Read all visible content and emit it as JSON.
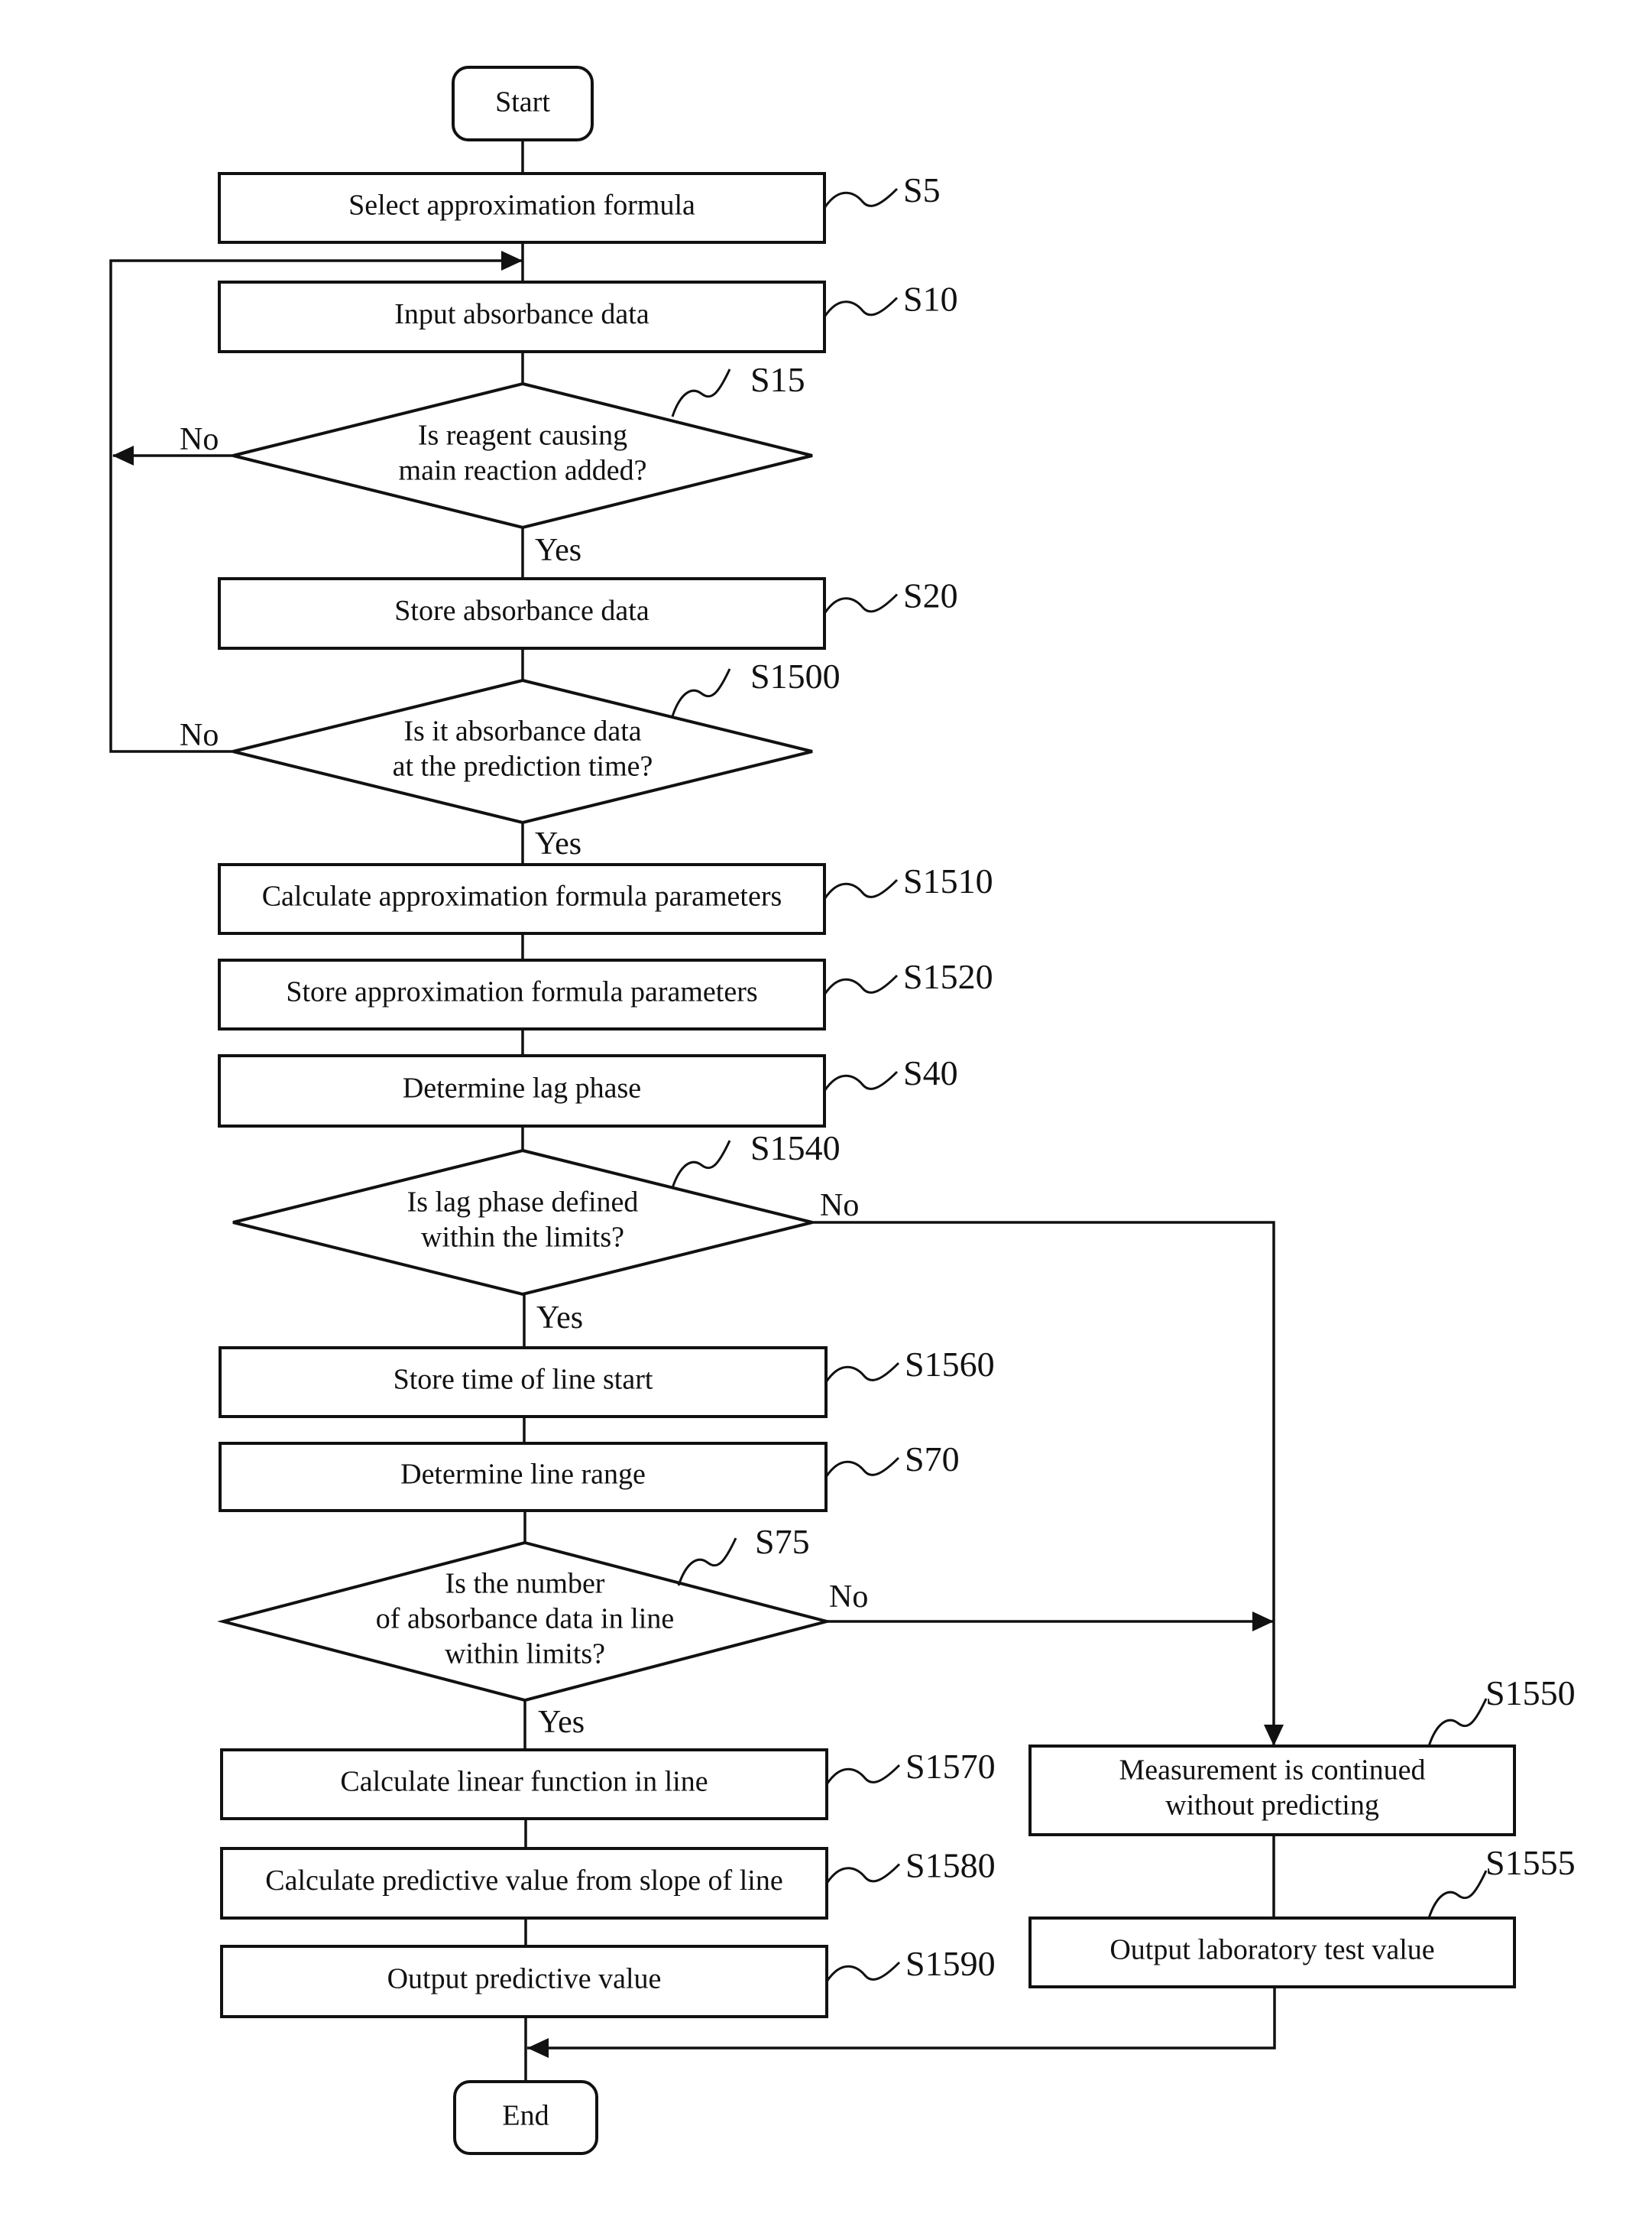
{
  "diagram": {
    "type": "flowchart",
    "terminals": {
      "start": "Start",
      "end": "End"
    },
    "nodes": [
      {
        "id": "S5",
        "kind": "process",
        "lines": [
          "Select approximation formula"
        ]
      },
      {
        "id": "S10",
        "kind": "process",
        "lines": [
          "Input absorbance data"
        ]
      },
      {
        "id": "S15",
        "kind": "decision",
        "lines": [
          "Is reagent causing",
          "main reaction added?"
        ]
      },
      {
        "id": "S20",
        "kind": "process",
        "lines": [
          "Store absorbance data"
        ]
      },
      {
        "id": "S1500",
        "kind": "decision",
        "lines": [
          "Is it absorbance data",
          "at the prediction time?"
        ]
      },
      {
        "id": "S1510",
        "kind": "process",
        "lines": [
          "Calculate approximation formula parameters"
        ]
      },
      {
        "id": "S1520",
        "kind": "process",
        "lines": [
          "Store approximation formula parameters"
        ]
      },
      {
        "id": "S40",
        "kind": "process",
        "lines": [
          "Determine lag phase"
        ]
      },
      {
        "id": "S1540",
        "kind": "decision",
        "lines": [
          "Is lag phase defined",
          "within the limits?"
        ]
      },
      {
        "id": "S1560",
        "kind": "process",
        "lines": [
          "Store time of line start"
        ]
      },
      {
        "id": "S70",
        "kind": "process",
        "lines": [
          "Determine line range"
        ]
      },
      {
        "id": "S75",
        "kind": "decision",
        "lines": [
          "Is the number",
          "of absorbance data in line",
          "within limits?"
        ]
      },
      {
        "id": "S1570",
        "kind": "process",
        "lines": [
          "Calculate linear function in line"
        ]
      },
      {
        "id": "S1580",
        "kind": "process",
        "lines": [
          "Calculate predictive value from slope of line"
        ]
      },
      {
        "id": "S1590",
        "kind": "process",
        "lines": [
          "Output predictive value"
        ]
      },
      {
        "id": "S1550",
        "kind": "process",
        "lines": [
          "Measurement is continued",
          "without predicting"
        ]
      },
      {
        "id": "S1555",
        "kind": "process",
        "lines": [
          "Output laboratory test value"
        ]
      }
    ],
    "branch_labels": {
      "yes": "Yes",
      "no": "No"
    },
    "edges": [
      {
        "from": "Start",
        "to": "S5"
      },
      {
        "from": "S5",
        "to": "S10"
      },
      {
        "from": "S10",
        "to": "S15"
      },
      {
        "from": "S15",
        "to": "S20",
        "label": "Yes"
      },
      {
        "from": "S15",
        "to": "S10",
        "label": "No"
      },
      {
        "from": "S20",
        "to": "S1500"
      },
      {
        "from": "S1500",
        "to": "S1510",
        "label": "Yes"
      },
      {
        "from": "S1500",
        "to": "S10",
        "label": "No"
      },
      {
        "from": "S1510",
        "to": "S1520"
      },
      {
        "from": "S1520",
        "to": "S40"
      },
      {
        "from": "S40",
        "to": "S1540"
      },
      {
        "from": "S1540",
        "to": "S1560",
        "label": "Yes"
      },
      {
        "from": "S1540",
        "to": "S1550",
        "label": "No"
      },
      {
        "from": "S1560",
        "to": "S70"
      },
      {
        "from": "S70",
        "to": "S75"
      },
      {
        "from": "S75",
        "to": "S1570",
        "label": "Yes"
      },
      {
        "from": "S75",
        "to": "S1550",
        "label": "No"
      },
      {
        "from": "S1570",
        "to": "S1580"
      },
      {
        "from": "S1580",
        "to": "S1590"
      },
      {
        "from": "S1590",
        "to": "End"
      },
      {
        "from": "S1550",
        "to": "S1555"
      },
      {
        "from": "S1555",
        "to": "End"
      }
    ]
  }
}
